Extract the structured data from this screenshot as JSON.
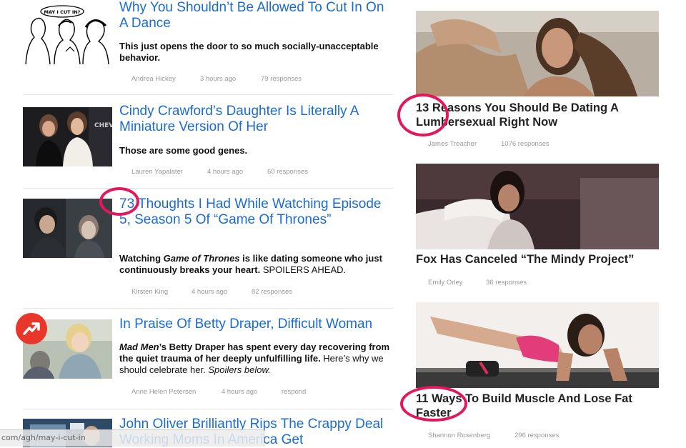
{
  "colors": {
    "link": "#1a6bd4",
    "highlight_ring": "#e3165e",
    "trending_badge": "#e8362b"
  },
  "feed": [
    {
      "title": "Why You Shouldn’t Be Allowed To Cut In On A Dance",
      "dek": "This just opens the door to so much socially-unacceptable behavior.",
      "author": "Andrea Hickey",
      "time": "3 hours ago",
      "responses": "79 responses",
      "thumb_caption": "MAY I CUT IN?"
    },
    {
      "title": "Cindy Crawford’s Daughter Is Literally A Miniature Version Of Her",
      "dek": "Those are some good genes.",
      "author": "Lauren Yapalater",
      "time": "4 hours ago",
      "responses": "60 responses",
      "thumb_caption": "CHEV"
    },
    {
      "title": "73 Thoughts I Had While Watching Episode 5, Season 5 Of “Game Of Thrones”",
      "dek_parts": [
        "Watching ",
        "Game of Thrones",
        " is like dating someone who just continuously breaks your heart. ",
        "SPOILERS AHEAD."
      ],
      "author": "Kirsten King",
      "time": "4 hours ago",
      "responses": "82 responses"
    },
    {
      "title": "In Praise Of Betty Draper, Difficult Woman",
      "dek_parts": [
        "Mad Men",
        "’s Betty Draper has spent every day recovering from the quiet trauma of her deeply unfulfilling life. ",
        "Here’s why we should celebrate her. ",
        "Spoilers below."
      ],
      "author": "Anne Helen Petersen",
      "time": "4 hours ago",
      "responses": "respond",
      "badge_icon": "trending-arrow-icon"
    },
    {
      "title": "John Oliver Brilliantly Rips The Crappy Deal Working Moms In America Get"
    }
  ],
  "sidebar": [
    {
      "title": "13 Reasons You Should Be Dating A Lumbersexual Right Now",
      "author": "James Treacher",
      "responses": "1076 responses"
    },
    {
      "title": "Fox Has Canceled “The Mindy Project”",
      "author": "Emily Orley",
      "responses": "36 responses"
    },
    {
      "title": "11 Ways To Build Muscle And Lose Fat Faster",
      "author": "Shannon Rosenberg",
      "responses": "296 responses"
    }
  ],
  "status_bar": {
    "url": "com/agh/may-i-cut-in"
  }
}
